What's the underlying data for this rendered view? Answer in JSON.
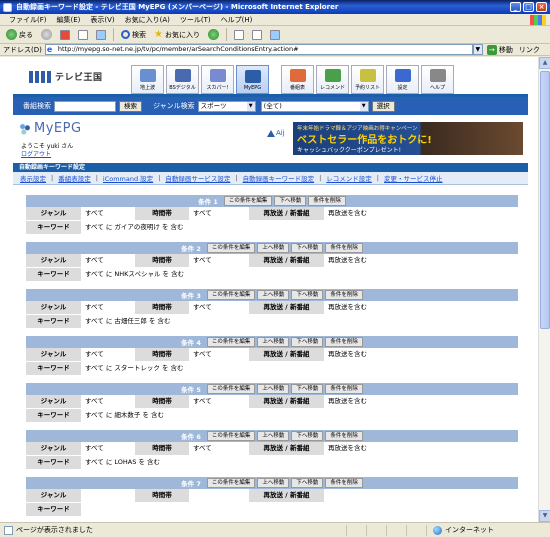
{
  "window": {
    "title": "自動録画キーワード設定 - テレビ王国 MyEPG (メンバーページ) - Microsoft Internet Explorer"
  },
  "menu": [
    "ファイル(F)",
    "編集(E)",
    "表示(V)",
    "お気に入り(A)",
    "ツール(T)",
    "ヘルプ(H)"
  ],
  "toolbar": {
    "back": "戻る",
    "search": "検索",
    "favorites": "お気に入り"
  },
  "address": {
    "label": "アドレス(D)",
    "url": "http://myepg.so-net.ne.jp/tv/pc/member/arSearchConditionsEntry.action#",
    "go": "移動",
    "links": "リンク"
  },
  "site": {
    "logo": "テレビ王国",
    "nav": [
      {
        "label": "地上波",
        "color": "#6a8fd0"
      },
      {
        "label": "BSデジタル",
        "color": "#4a6ab0"
      },
      {
        "label": "スカパー!",
        "color": "#7a8ad0"
      },
      {
        "label": "MyEPG",
        "color": "#2d5ca8"
      },
      {
        "label": "番組表",
        "color": "#e06a3a"
      },
      {
        "label": "レコメンド",
        "color": "#4aa04a"
      },
      {
        "label": "予約リスト",
        "color": "#c8c040"
      },
      {
        "label": "設定",
        "color": "#3a6ad0"
      },
      {
        "label": "ヘルプ",
        "color": "#888888"
      }
    ],
    "search": {
      "label": "番組検索",
      "button": "検索",
      "genre_label": "ジャンル検索",
      "genre_value": "スポーツ",
      "sub_value": "(全て)",
      "select_button": "選択"
    },
    "brand": {
      "myepg": "MyEPG",
      "welcome": "ようこそ yuki さん",
      "logout": "ログアウト",
      "aij": "Aij",
      "banner_small": "年末年始ドラマ韓＆アジア映画お得キャンペーン",
      "banner_big": "ベストセラー作品をおトクに!",
      "banner_sub": "キャッシュバッククーポンプレゼント!"
    },
    "section_title": "自動録画キーワード設定",
    "subnav": [
      "表示設定",
      "番組表設定",
      "iCommand 設定",
      "自動録画サービス設定",
      "自動録画キーワード設定",
      "レコメンド設定",
      "変更・サービス停止"
    ],
    "labels": {
      "genre": "ジャンル",
      "time": "時間帯",
      "rebroadcast": "再放送 / 新番組",
      "keyword": "キーワード",
      "btn_prev": "この条件を編集",
      "btn_up": "上へ移動",
      "btn_down": "下へ移動",
      "btn_delete": "条件を削除"
    },
    "conditions": [
      {
        "name": "条件 1",
        "head_first": "この条件を編集",
        "genre": "すべて",
        "time": "すべて",
        "rebroadcast": "再放送を含む",
        "keyword": "すべて に ガイアの夜明け を 含む"
      },
      {
        "name": "条件 2",
        "head_first": "この条件を編集",
        "genre": "すべて",
        "time": "すべて",
        "rebroadcast": "再放送を含む",
        "keyword": "すべて に NHKスペシャル を 含む"
      },
      {
        "name": "条件 3",
        "head_first": "この条件を編集",
        "genre": "すべて",
        "time": "すべて",
        "rebroadcast": "再放送を含む",
        "keyword": "すべて に 古畑任三郎 を 含む"
      },
      {
        "name": "条件 4",
        "head_first": "この条件を編集",
        "genre": "すべて",
        "time": "すべて",
        "rebroadcast": "再放送を含む",
        "keyword": "すべて に スタートレック を 含む"
      },
      {
        "name": "条件 5",
        "head_first": "この条件を編集",
        "genre": "すべて",
        "time": "すべて",
        "rebroadcast": "再放送を含む",
        "keyword": "すべて に 細木数子 を 含む"
      },
      {
        "name": "条件 6",
        "head_first": "この条件を編集",
        "genre": "すべて",
        "time": "すべて",
        "rebroadcast": "再放送を含む",
        "keyword": "すべて に LOHAS を 含む"
      },
      {
        "name": "条件 7",
        "head_first": "この条件を編集",
        "genre": "",
        "time": "",
        "rebroadcast": "",
        "keyword": ""
      }
    ]
  },
  "status": {
    "text": "ページが表示されました",
    "zone": "インターネット"
  }
}
